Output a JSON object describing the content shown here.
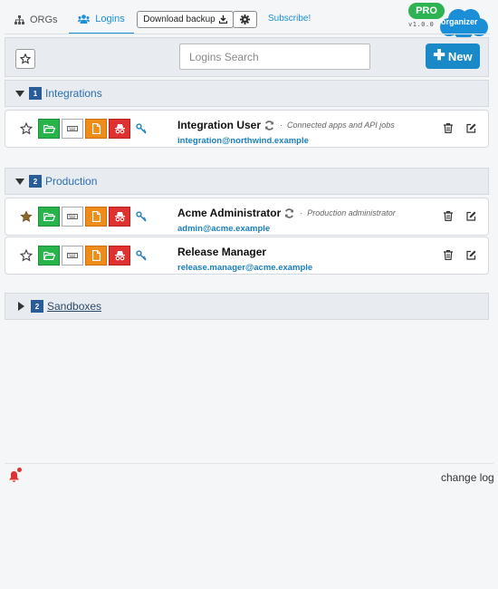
{
  "nav": {
    "tabs": [
      {
        "label": "ORGs",
        "icon": "sitemap-icon"
      },
      {
        "label": "Logins",
        "icon": "users-icon",
        "active": true
      }
    ],
    "download_label": "Download backup",
    "subscribe_label": "Subscribe!",
    "pro_label": "PRO",
    "version": "v1.0.0",
    "logo_text": "organizer"
  },
  "toolbar": {
    "search_placeholder": "Logins Search",
    "new_label": "New"
  },
  "groups": [
    {
      "name": "Integrations",
      "count": "1",
      "expanded": true,
      "logins": [
        {
          "name": "Integration User",
          "description": "Connected apps and API jobs",
          "username": "integration@northwind.example",
          "starred": false,
          "refresh": true
        }
      ]
    },
    {
      "name": "Production",
      "count": "2",
      "expanded": true,
      "logins": [
        {
          "name": "Acme Administrator",
          "description": "Production administrator",
          "username": "admin@acme.example",
          "starred": true,
          "refresh": true
        },
        {
          "name": "Release Manager",
          "description": "",
          "username": "release.manager@acme.example",
          "starred": false,
          "refresh": false
        }
      ]
    },
    {
      "name": "Sandboxes",
      "count": "2",
      "expanded": false,
      "logins": []
    }
  ],
  "footer": {
    "changelog_label": "change log"
  },
  "colors": {
    "accent": "#1a8fd8",
    "pro_green": "#2db352",
    "folder_green": "#28b44a",
    "doc_orange": "#f08c1a",
    "incognito_red": "#e03131",
    "badge_blue": "#2a5d97",
    "starred": "#8a6a2a"
  }
}
